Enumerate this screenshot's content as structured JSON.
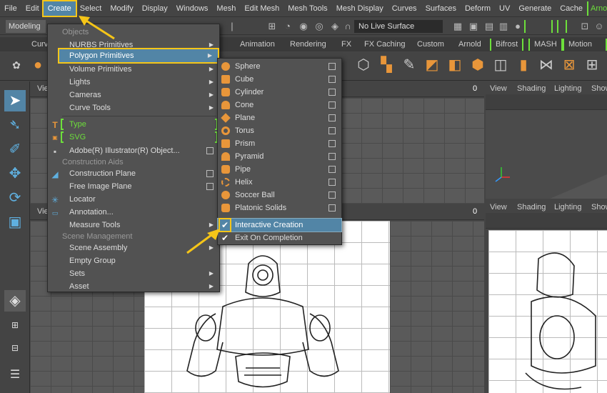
{
  "menubar": [
    "File",
    "Edit",
    "Create",
    "Select",
    "Modify",
    "Display",
    "Windows",
    "Mesh",
    "Edit Mesh",
    "Mesh Tools",
    "Mesh Display",
    "Curves",
    "Surfaces",
    "Deform",
    "UV",
    "Generate",
    "Cache",
    "Arnold"
  ],
  "status": {
    "mode": "Modeling",
    "live_surface": "No Live Surface"
  },
  "shelf_tabs": [
    "Curv",
    "Animation",
    "Rendering",
    "FX",
    "FX Caching",
    "Custom",
    "Arnold",
    "Bifrost",
    "MASH",
    "Motion Gra"
  ],
  "viewport_top_right": [
    "View",
    "Shading",
    "Lighting",
    "Show"
  ],
  "viewport_bottom_right": [
    "View",
    "Shading",
    "Lighting",
    "Show"
  ],
  "viewport_left_label": "Vie",
  "create_menu": {
    "section_objects": "Objects",
    "nurbs": "NURBS Primitives",
    "polygon": "Polygon Primitives",
    "volume": "Volume Primitives",
    "lights": "Lights",
    "cameras": "Cameras",
    "curve_tools": "Curve Tools",
    "type": "Type",
    "svg": "SVG",
    "illustrator": "Adobe(R) Illustrator(R) Object...",
    "section_construction": "Construction Aids",
    "construction_plane": "Construction Plane",
    "free_image_plane": "Free Image Plane",
    "locator": "Locator",
    "annotation": "Annotation...",
    "measure_tools": "Measure Tools",
    "section_scene": "Scene Management",
    "scene_assembly": "Scene Assembly",
    "empty_group": "Empty Group",
    "sets": "Sets",
    "asset": "Asset"
  },
  "polygon_menu": [
    "Sphere",
    "Cube",
    "Cylinder",
    "Cone",
    "Plane",
    "Torus",
    "Prism",
    "Pyramid",
    "Pipe",
    "Helix",
    "Soccer Ball",
    "Platonic Solids"
  ],
  "polygon_options": {
    "interactive": "Interactive Creation",
    "exit": "Exit On Completion"
  },
  "zero_label": "0"
}
